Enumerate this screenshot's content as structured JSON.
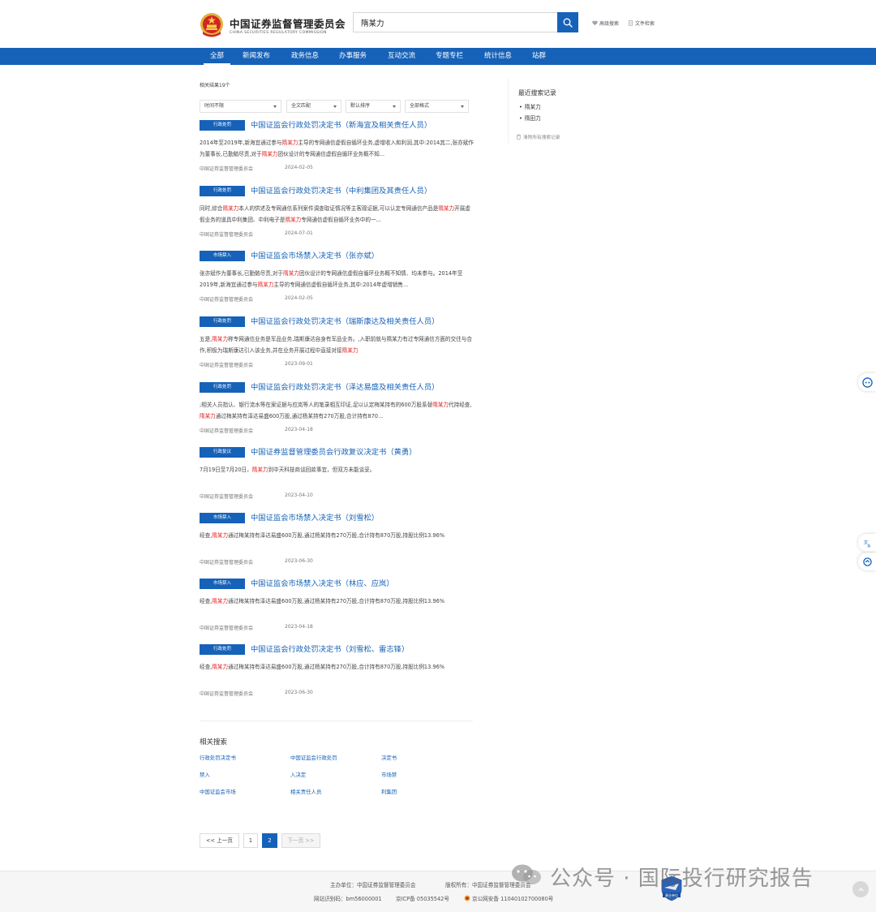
{
  "header": {
    "org_name_cn": "中国证券监督管理委员会",
    "org_name_en": "CHINA SECURITIES REGULATORY COMMISSION",
    "search_value": "隋某力",
    "advanced_search": "高级搜索",
    "doc_search": "文件检索"
  },
  "nav": {
    "items": [
      "全部",
      "新闻发布",
      "政务信息",
      "办事服务",
      "互动交流",
      "专题专栏",
      "统计信息",
      "站群"
    ],
    "active_index": 0
  },
  "results_meta": {
    "count_text": "相关结果19个",
    "filters": [
      "时间不限",
      "全文匹配",
      "默认排序",
      "全部格式"
    ]
  },
  "results": [
    {
      "badge": "行政处罚",
      "title": "中国证监会行政处罚决定书（新海宜及相关责任人员）",
      "snippet": [
        {
          "t": "2014年至2019年,新海宜通过参与"
        },
        {
          "t": "隋某力",
          "hl": true
        },
        {
          "t": "主导的专网通信虚假自循环业务,虚增收入和利润,其中:2014其二,张亦斌作为董事长,已勤勉尽责,对于"
        },
        {
          "t": "隋某力",
          "hl": true
        },
        {
          "t": "团伙设计的专网通信虚假自循环业务概不知..."
        }
      ],
      "source": "中国证券监督管理委员会",
      "date": "2024-02-05"
    },
    {
      "badge": "行政处罚",
      "title": "中国证监会行政处罚决定书（中利集团及其责任人员）",
      "snippet": [
        {
          "t": "同时,综合"
        },
        {
          "t": "隋某力",
          "hl": true
        },
        {
          "t": "本人的供述及专网通信系列案件调查取证情况等主客观证据,可以认定专网通信产品是"
        },
        {
          "t": "隋某力",
          "hl": true
        },
        {
          "t": "开展虚假业务的道具中利集团、中利电子是"
        },
        {
          "t": "隋某力",
          "hl": true
        },
        {
          "t": "专网通信虚假自循环业务中的一..."
        }
      ],
      "source": "中国证券监督管理委员会",
      "date": "2024-07-01"
    },
    {
      "badge": "市场禁入",
      "title": "中国证监会市场禁入决定书（张亦斌）",
      "snippet": [
        {
          "t": "张亦斌作为董事长,已勤勉尽责,对于"
        },
        {
          "t": "隋某力",
          "hl": true
        },
        {
          "t": "团伙设计的专网通信虚假自循环业务概不知情、均未参与。2014年至2019年,新海宜通过参与"
        },
        {
          "t": "隋某力",
          "hl": true
        },
        {
          "t": "主导的专网通信虚假自循环业务,其中:2014年虚增销售..."
        }
      ],
      "source": "中国证券监督管理委员会",
      "date": "2024-02-05"
    },
    {
      "badge": "行政处罚",
      "title": "中国证监会行政处罚决定书（瑞斯康达及相关责任人员）",
      "snippet": [
        {
          "t": "五是,"
        },
        {
          "t": "隋某力",
          "hl": true
        },
        {
          "t": "称专网通信业务是军品业务,瑞斯康达自身有军品业务。,入职前就与隋某力有过专网通信方面的交往与合作,积极为瑞斯康达引入该业务,并在业务开展过程中直接对接"
        },
        {
          "t": "隋某力",
          "hl": true
        }
      ],
      "source": "中国证券监督管理委员会",
      "date": "2023-09-01"
    },
    {
      "badge": "行政处罚",
      "title": "中国证监会行政处罚决定书（泽达易盛及相关责任人员）",
      "snippet": [
        {
          "t": ";相关人员指认、银行流水等在案证据与应岚等人的笔录相互印证,足以认定梅某持有的600万股系替"
        },
        {
          "t": "隋某力",
          "hl": true
        },
        {
          "t": "代持经查,"
        },
        {
          "t": "隋某力",
          "hl": true
        },
        {
          "t": "通过梅某持有泽达易盛600万股,通过杨某持有270万股,合计持有870..."
        }
      ],
      "source": "中国证券监督管理委员会",
      "date": "2023-04-18"
    },
    {
      "badge": "行政复议",
      "title": "中国证券监督管理委员会行政复议决定书（黄勇）",
      "snippet": [
        {
          "t": "7月19日至7月20日，"
        },
        {
          "t": "隋某力",
          "hl": true
        },
        {
          "t": "到中天科技商谈回款事宜，但双方未能谈妥。"
        }
      ],
      "source": "中国证券监督管理委员会",
      "date": "2023-04-10"
    },
    {
      "badge": "市场禁入",
      "title": "中国证监会市场禁入决定书（刘雪松）",
      "snippet": [
        {
          "t": "经查,"
        },
        {
          "t": "隋某力",
          "hl": true
        },
        {
          "t": "通过梅某持有泽达易盛600万股,通过杨某持有270万股,合计持有870万股,持股比例13.96%"
        }
      ],
      "source": "中国证券监督管理委员会",
      "date": "2023-06-30"
    },
    {
      "badge": "市场禁入",
      "title": "中国证监会市场禁入决定书（林应、应岚）",
      "snippet": [
        {
          "t": "经查,"
        },
        {
          "t": "隋某力",
          "hl": true
        },
        {
          "t": "通过梅某持有泽达易盛600万股,通过杨某持有270万股,合计持有870万股,持股比例13.96%"
        }
      ],
      "source": "中国证券监督管理委员会",
      "date": "2023-04-18"
    },
    {
      "badge": "行政处罚",
      "title": "中国证监会行政处罚决定书（刘雪松、雷志锋）",
      "snippet": [
        {
          "t": "经查,"
        },
        {
          "t": "隋某力",
          "hl": true
        },
        {
          "t": "通过梅某持有泽达易盛600万股,通过杨某持有270万股,合计持有870万股,持股比例13.96%"
        }
      ],
      "source": "中国证券监督管理委员会",
      "date": "2023-06-30"
    }
  ],
  "related": {
    "title": "相关搜索",
    "links": [
      "行政处罚决定书",
      "中国证监会行政处罚",
      "决定书",
      "禁入",
      "入决定",
      "市场禁",
      "中国证监会市场",
      "相关责任人员",
      "利集团"
    ]
  },
  "pagination": {
    "prev": "<< 上一页",
    "pages": [
      "1",
      "2"
    ],
    "current": "2",
    "next": "下一页 >>"
  },
  "sidebar": {
    "title": "最近搜索记录",
    "items": [
      "隋某力",
      "隋田力"
    ],
    "clear": "清除所有搜索记录"
  },
  "float_tools": {
    "accessibility": "无"
  },
  "footer": {
    "sponsor": "主办单位：中国证券监督管理委员会",
    "copyright": "版权所有：中国证券监督管理委员会",
    "site_id": "网站识别码：bm56000001",
    "icp": "京ICP备 05035542号",
    "police": "京公网安备 11040102700080号",
    "gov_badge_text": "事业单位"
  },
  "watermark": {
    "text": "公众号 · 国际投行研究报告"
  },
  "colors": {
    "brand": "#1662b8",
    "highlight": "#e02020"
  }
}
